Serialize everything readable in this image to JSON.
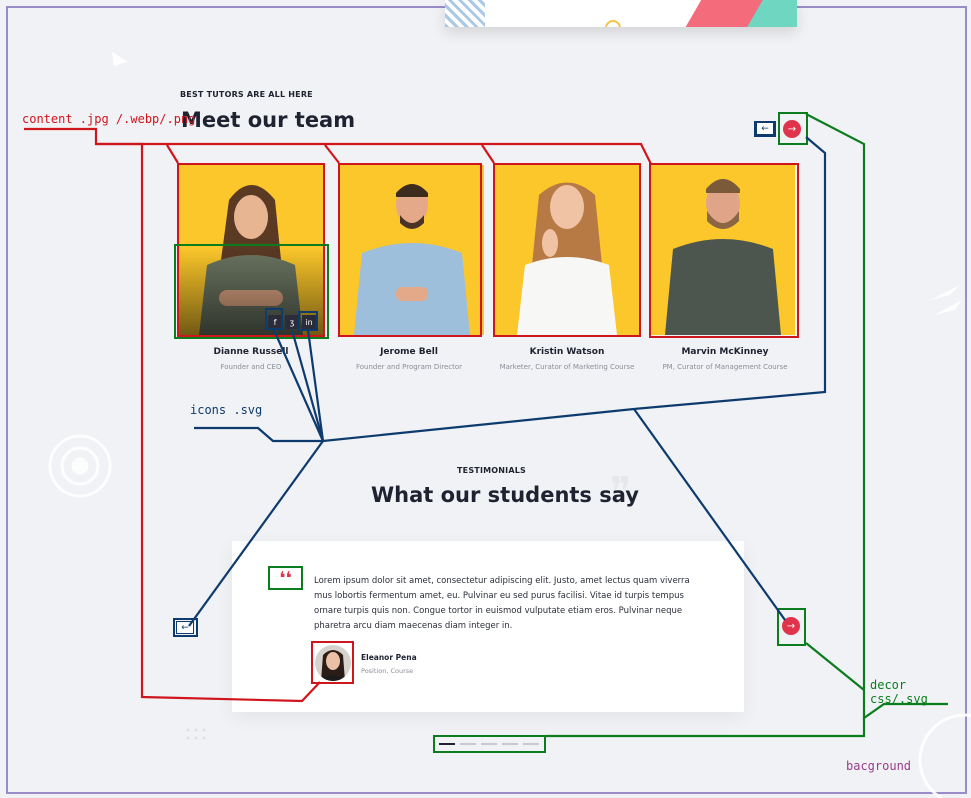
{
  "team": {
    "eyebrow": "BEST TUTORS ARE ALL HERE",
    "title": "Meet our team",
    "members": [
      {
        "name": "Dianne Russell",
        "role": "Founder and CEO"
      },
      {
        "name": "Jerome Bell",
        "role": "Founder and Program Director"
      },
      {
        "name": "Kristin Watson",
        "role": "Marketer, Curator of Marketing Course"
      },
      {
        "name": "Marvin McKinney",
        "role": "PM, Curator of Management Course"
      }
    ],
    "social_icons": [
      "f",
      "ʒ",
      "in"
    ]
  },
  "testimonials": {
    "eyebrow": "TESTIMONIALS",
    "title": "What our students say",
    "quote": "Lorem ipsum dolor sit amet, consectetur adipiscing elit. Justo, amet lectus quam viverra mus lobortis fermentum amet, eu. Pulvinar eu sed purus facilisi. Vitae id turpis tempus ornare turpis quis non. Congue tortor in euismod vulputate etiam eros. Pulvinar neque pharetra arcu diam maecenas diam integer in.",
    "author_name": "Eleanor Pena",
    "author_position": "Position, Course",
    "quote_mark": "❛❛"
  },
  "nav": {
    "prev_arrow": "←",
    "next_arrow": "→"
  },
  "annotations": {
    "content": "content .jpg /.webp/.png",
    "icons": "icons .svg",
    "decor": "decor css/.svg",
    "background": "bacground"
  },
  "colors": {
    "accent": "#e0344c",
    "photo_bg": "#fcc72a",
    "content_annotation": "#d0161d",
    "decor_annotation": "#0b7d1f",
    "icons_annotation": "#0d3b6e",
    "background_annotation": "#9a3c8c"
  }
}
